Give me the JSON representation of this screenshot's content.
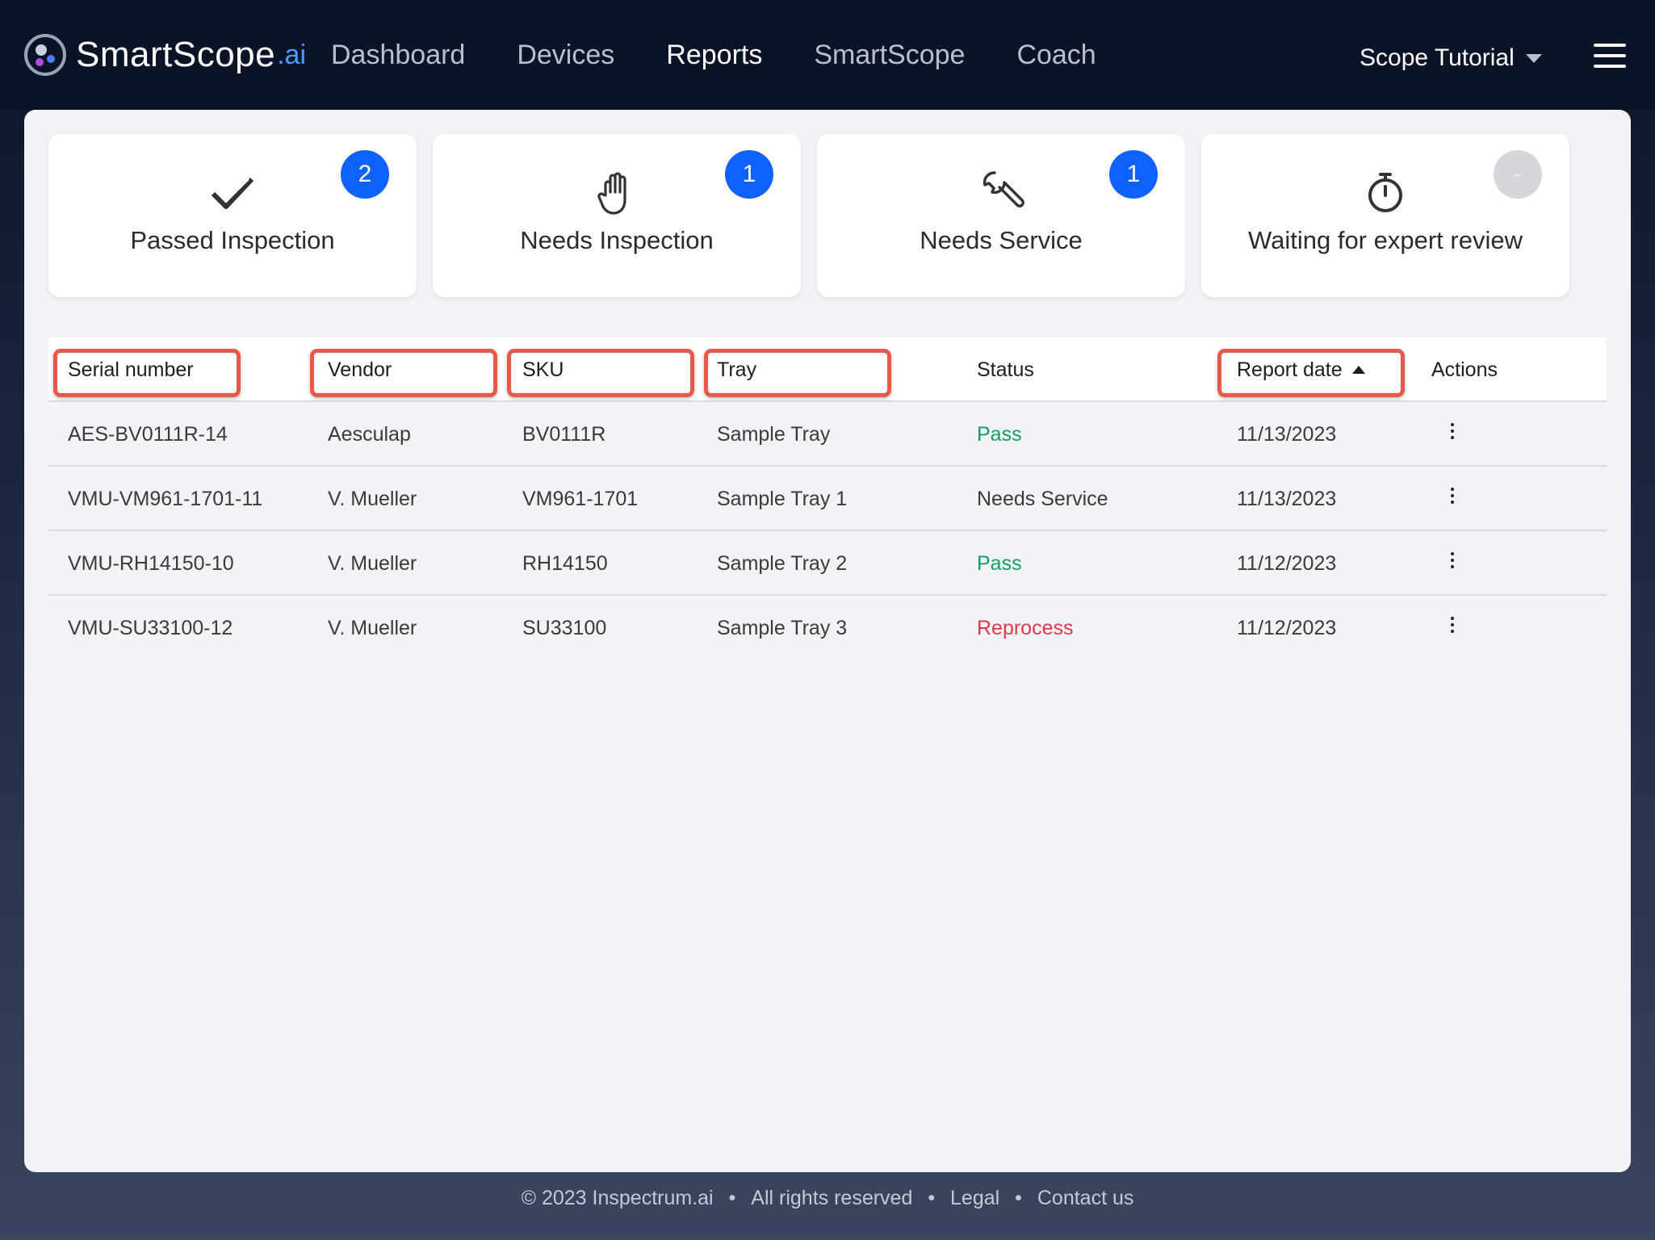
{
  "brand": {
    "name": "SmartScope",
    "suffix": ".ai"
  },
  "nav": {
    "items": [
      {
        "label": "Dashboard",
        "active": false
      },
      {
        "label": "Devices",
        "active": false
      },
      {
        "label": "Reports",
        "active": true
      },
      {
        "label": "SmartScope",
        "active": false
      },
      {
        "label": "Coach",
        "active": false
      }
    ],
    "user_menu": "Scope Tutorial"
  },
  "cards": [
    {
      "label": "Passed Inspection",
      "count": "2",
      "icon": "check-icon"
    },
    {
      "label": "Needs Inspection",
      "count": "1",
      "icon": "hand-icon"
    },
    {
      "label": "Needs Service",
      "count": "1",
      "icon": "wrench-icon"
    },
    {
      "label": "Waiting for expert review",
      "count": "-",
      "icon": "stopwatch-icon"
    }
  ],
  "table": {
    "headers": {
      "serial": "Serial number",
      "vendor": "Vendor",
      "sku": "SKU",
      "tray": "Tray",
      "status": "Status",
      "report_date": "Report date",
      "actions": "Actions"
    },
    "sort": {
      "column": "report_date",
      "direction": "ascending"
    },
    "highlight_color": "#e8584b",
    "rows": [
      {
        "serial": "AES-BV0111R-14",
        "vendor": "Aesculap",
        "sku": "BV0111R",
        "tray": "Sample Tray",
        "status": "Pass",
        "date": "11/13/2023"
      },
      {
        "serial": "VMU-VM961-1701-11",
        "vendor": "V. Mueller",
        "sku": "VM961-1701",
        "tray": "Sample Tray 1",
        "status": "Needs Service",
        "date": "11/13/2023"
      },
      {
        "serial": "VMU-RH14150-10",
        "vendor": "V. Mueller",
        "sku": "RH14150",
        "tray": "Sample Tray 2",
        "status": "Pass",
        "date": "11/12/2023"
      },
      {
        "serial": "VMU-SU33100-12",
        "vendor": "V. Mueller",
        "sku": "SU33100",
        "tray": "Sample Tray 3",
        "status": "Reprocess",
        "date": "11/12/2023"
      }
    ]
  },
  "colors": {
    "accent": "#0f62fe",
    "pass": "#169e5f",
    "reprocess": "#e0384a",
    "nav_bg": "#0b1426"
  },
  "footer": {
    "copyright": "© 2023 Inspectrum.ai",
    "rights": "All rights reserved",
    "legal": "Legal",
    "contact": "Contact us",
    "separator": "•"
  }
}
